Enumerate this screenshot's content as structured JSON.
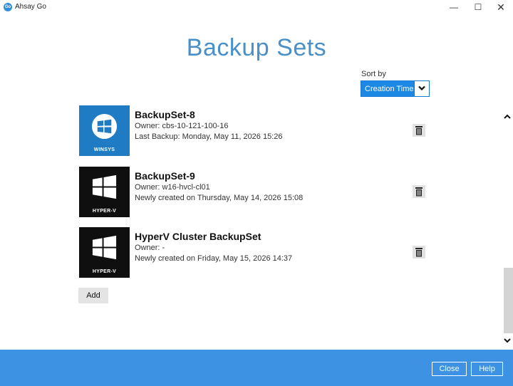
{
  "window": {
    "app_icon_text": "Go",
    "title": "Ahsay Go",
    "minimize_glyph": "—",
    "maximize_glyph": "☐",
    "close_glyph": "✕"
  },
  "page": {
    "title": "Backup Sets"
  },
  "sort": {
    "label": "Sort by",
    "selected": "Creation Time"
  },
  "backup_sets": [
    {
      "name": "BackupSet-8",
      "type_label": "WINSYS",
      "owner": "Owner: cbs-10-121-100-16",
      "info": "Last Backup: Monday, May 11, 2026 15:26"
    },
    {
      "name": "BackupSet-9",
      "type_label": "HYPER-V",
      "owner": "Owner: w16-hvcl-cl01",
      "info": "Newly created on Thursday, May 14, 2026 15:08"
    },
    {
      "name": "HyperV Cluster BackupSet",
      "type_label": "HYPER-V",
      "owner": "Owner: -",
      "info": "Newly created on Friday, May 15, 2026 14:37"
    }
  ],
  "actions": {
    "add_label": "Add"
  },
  "footer": {
    "close_label": "Close",
    "help_label": "Help"
  },
  "colors": {
    "accent": "#3d92e3",
    "title": "#4a90c8",
    "winsys_tile": "#1f7cc4",
    "hyperv_tile": "#0f0f0f"
  },
  "icons": {
    "delete": "trash-icon",
    "sort_dropdown": "chevron-down-icon",
    "scroll_up": "chevron-up-icon",
    "scroll_down": "chevron-down-icon",
    "windows_logo": "windows-logo-icon"
  }
}
